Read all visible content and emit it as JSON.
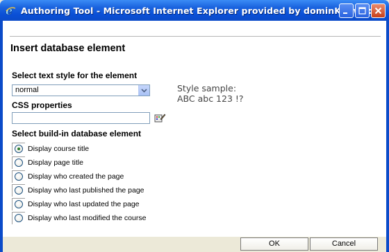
{
  "window": {
    "title": "Authoring Tool - Microsoft Internet Explorer provided by dominKnow|:::"
  },
  "dialog": {
    "heading": "Insert database element",
    "text_style_label": "Select text style for the element",
    "text_style_value": "normal",
    "css_label": "CSS properties",
    "css_value": "",
    "sample_title": "Style sample:",
    "sample_text": "ABC abc 123 !?",
    "element_label": "Select build-in database element",
    "options": [
      {
        "label": "Display course title",
        "checked": true
      },
      {
        "label": "Display page title",
        "checked": false
      },
      {
        "label": "Display who created the page",
        "checked": false
      },
      {
        "label": "Display who last published the page",
        "checked": false
      },
      {
        "label": "Display who last updated the page",
        "checked": false
      },
      {
        "label": "Display who last modified the course",
        "checked": false
      }
    ]
  },
  "buttons": {
    "ok": "OK",
    "cancel": "Cancel"
  },
  "icons": {
    "app": "internet-explorer-icon",
    "minimize": "minimize-icon",
    "maximize": "maximize-icon",
    "close": "close-icon",
    "css_picker": "style-picker-icon",
    "dropdown": "chevron-down-icon"
  },
  "colors": {
    "titlebar": "#0b4bc9",
    "close_button": "#c8401b",
    "window_bg": "#ffffff",
    "chrome_bg": "#ece9d8"
  }
}
